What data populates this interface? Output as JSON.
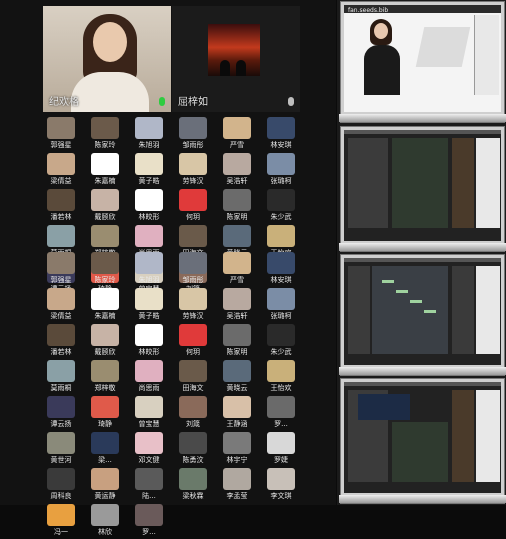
{
  "gallery": {
    "featured": [
      {
        "name": "纪欢格",
        "mic": "active"
      },
      {
        "name": "屈梓如",
        "mic": "muted"
      }
    ],
    "grid_top": [
      {
        "name": "郭强星",
        "color": "#8a7a6a"
      },
      {
        "name": "陈家玲",
        "color": "#6b5a4a"
      },
      {
        "name": "朱旭羽",
        "color": "#b0b7c8"
      },
      {
        "name": "邹雨彤",
        "color": "#6a6f7a"
      },
      {
        "name": "严雪",
        "color": "#d2b48c"
      },
      {
        "name": "林安琪",
        "color": "#384a6a"
      },
      {
        "name": "梁倩益",
        "color": "#c8a88a"
      },
      {
        "name": "朱嘉楠",
        "color": "#ffffff"
      },
      {
        "name": "黄子皓",
        "color": "#e9e0c8"
      },
      {
        "name": "劳锋汉",
        "color": "#d8c6a6"
      },
      {
        "name": "吴浩轩",
        "color": "#b8a9a0"
      },
      {
        "name": "张璐柯",
        "color": "#7b8da6"
      },
      {
        "name": "潘若林",
        "color": "#5a4a3a"
      },
      {
        "name": "戴颐欣",
        "color": "#c7b3a6"
      },
      {
        "name": "林皎形",
        "color": "#ffffff"
      },
      {
        "name": "何玥",
        "color": "#e03a3a"
      },
      {
        "name": "陈家明",
        "color": "#6b6b6b"
      },
      {
        "name": "朱少武",
        "color": "#2a2a2a"
      },
      {
        "name": "莫雨桐",
        "color": "#8aa0a6"
      },
      {
        "name": "郑梓敬",
        "color": "#9a8d70"
      },
      {
        "name": "尚思雨",
        "color": "#e0b0c0"
      },
      {
        "name": "田海文",
        "color": "#6a5a4a"
      },
      {
        "name": "黄晓云",
        "color": "#5a6a7a"
      },
      {
        "name": "王怡欢",
        "color": "#c9b07a"
      },
      {
        "name": "谭云扬",
        "color": "#3a3a5a"
      },
      {
        "name": "琦静",
        "color": "#e05a4a"
      },
      {
        "name": "曾宝慧",
        "color": "#d8d0c0"
      },
      {
        "name": "刘箴",
        "color": "#8a6a5a"
      }
    ],
    "grid_bottom": [
      {
        "name": "郭强星",
        "color": "#8a7a6a"
      },
      {
        "name": "陈家玲",
        "color": "#6b5a4a"
      },
      {
        "name": "朱旭羽",
        "color": "#b0b7c8"
      },
      {
        "name": "邹雨彤",
        "color": "#6a6f7a"
      },
      {
        "name": "严雪",
        "color": "#d2b48c"
      },
      {
        "name": "林安琪",
        "color": "#384a6a"
      },
      {
        "name": "梁倩益",
        "color": "#c8a88a"
      },
      {
        "name": "朱嘉楠",
        "color": "#ffffff"
      },
      {
        "name": "黄子皓",
        "color": "#e9e0c8"
      },
      {
        "name": "劳锋汉",
        "color": "#d8c6a6"
      },
      {
        "name": "吴浩轩",
        "color": "#b8a9a0"
      },
      {
        "name": "张璐柯",
        "color": "#7b8da6"
      },
      {
        "name": "潘若林",
        "color": "#5a4a3a"
      },
      {
        "name": "戴颐欣",
        "color": "#c7b3a6"
      },
      {
        "name": "林皎形",
        "color": "#ffffff"
      },
      {
        "name": "何玥",
        "color": "#e03a3a"
      },
      {
        "name": "陈家明",
        "color": "#6b6b6b"
      },
      {
        "name": "朱少武",
        "color": "#2a2a2a"
      },
      {
        "name": "莫雨桐",
        "color": "#8aa0a6"
      },
      {
        "name": "郑梓敬",
        "color": "#9a8d70"
      },
      {
        "name": "尚思雨",
        "color": "#e0b0c0"
      },
      {
        "name": "田海文",
        "color": "#6a5a4a"
      },
      {
        "name": "黄晓云",
        "color": "#5a6a7a"
      },
      {
        "name": "王怡欢",
        "color": "#c9b07a"
      },
      {
        "name": "谭云扬",
        "color": "#3a3a5a"
      },
      {
        "name": "琦静",
        "color": "#e05a4a"
      },
      {
        "name": "曾宝慧",
        "color": "#d8d0c0"
      },
      {
        "name": "刘箴",
        "color": "#8a6a5a"
      },
      {
        "name": "王静涵",
        "color": "#d8c0a8"
      },
      {
        "name": "罗...",
        "color": "#6a6a6a"
      },
      {
        "name": "黄世河",
        "color": "#8a8a7a"
      },
      {
        "name": "梁...",
        "color": "#2a3a5a"
      },
      {
        "name": "邓文健",
        "color": "#e8c0c8"
      },
      {
        "name": "陈勇汶",
        "color": "#4a4a4a"
      },
      {
        "name": "林宇宁",
        "color": "#7a7a7a"
      },
      {
        "name": "罗婕",
        "color": "#d8d8d8"
      },
      {
        "name": "周科良",
        "color": "#3a3a3a"
      },
      {
        "name": "黄运静",
        "color": "#c8a080"
      },
      {
        "name": "陆...",
        "color": "#5a5a5a"
      },
      {
        "name": "梁秋霖",
        "color": "#6a7a6a"
      },
      {
        "name": "李孟莹",
        "color": "#b0a8a0"
      },
      {
        "name": "李文琪",
        "color": "#c8c0b8"
      },
      {
        "name": "冯一",
        "color": "#e8a040"
      },
      {
        "name": "林欣",
        "color": "#9a9a9a"
      },
      {
        "name": "罗...",
        "color": "#6a5a5a"
      }
    ]
  },
  "screens": {
    "window_title": "fan.seeds.bib"
  }
}
